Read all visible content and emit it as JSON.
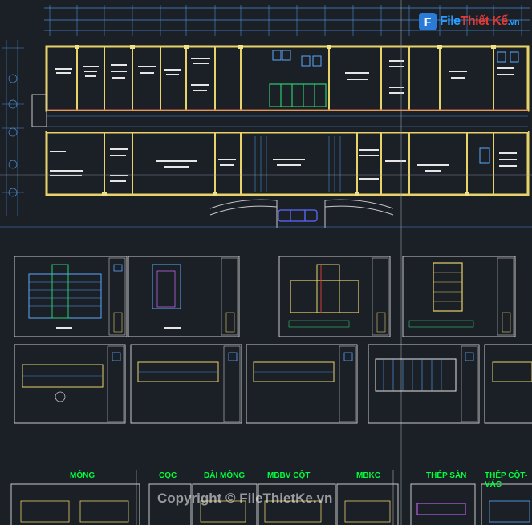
{
  "watermark": {
    "logo_letter": "F",
    "logo_text_main": "File",
    "logo_text_accent": "Thiết Kế",
    "logo_suffix": ".vn",
    "copyright": "Copyright © FileThietKe.vn"
  },
  "section_labels": [
    "MÓNG",
    "CỌC",
    "ĐÀI MÓNG",
    "MBBV CỘT",
    "MBKC",
    "THÉP SÀN",
    "THÉP CỘT-VÁC"
  ],
  "colors": {
    "background": "#1b1f26",
    "wall": "#e8d36a",
    "dimension": "#4a8fd6",
    "label_green": "#00ff3c",
    "frame": "#c8c8c8",
    "red_line": "#d23b3b"
  }
}
